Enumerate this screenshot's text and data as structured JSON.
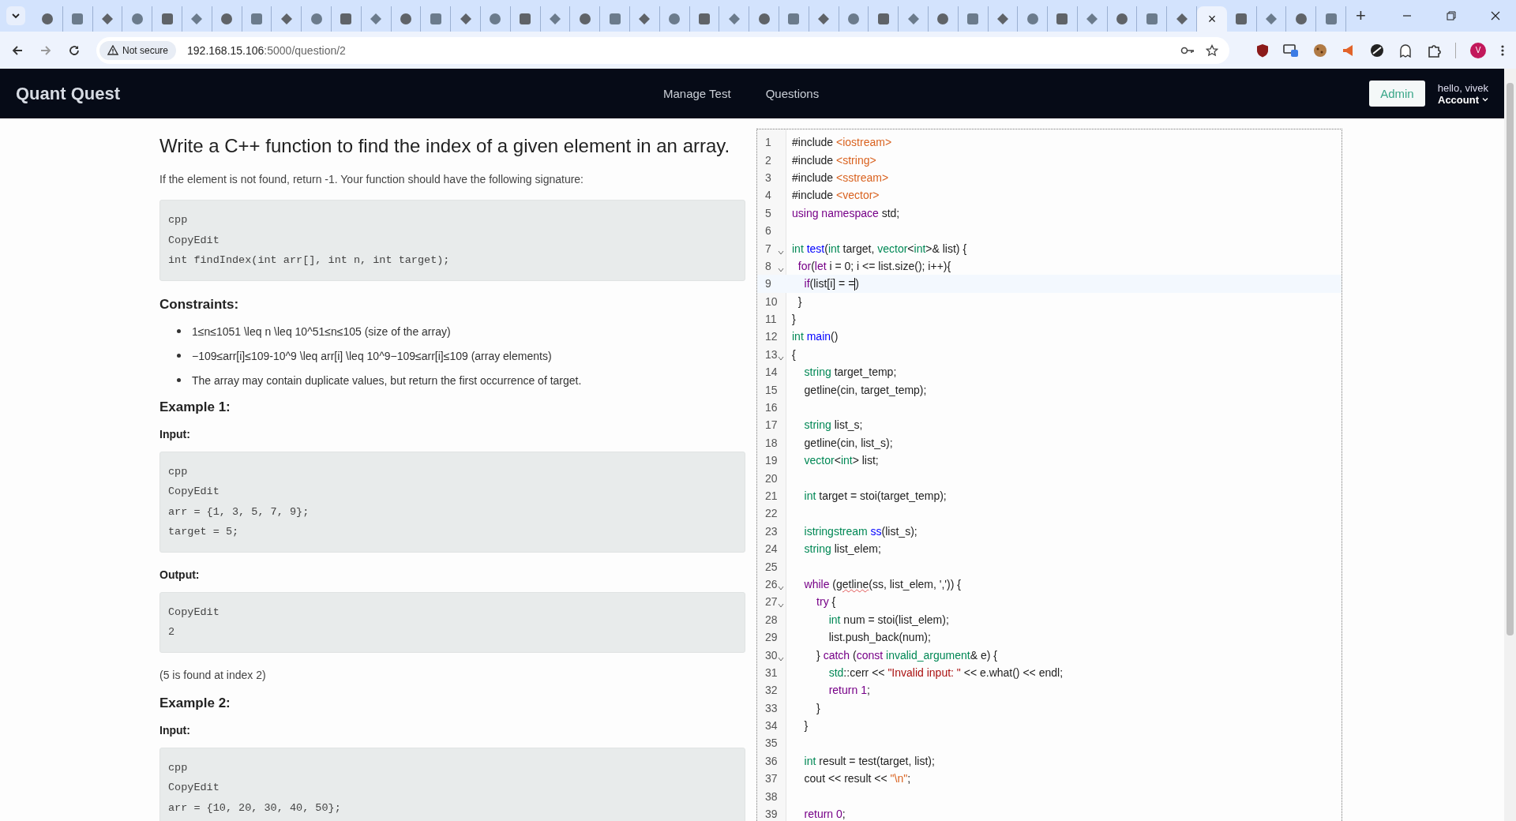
{
  "browser": {
    "tabs": [
      {
        "selected": false
      },
      {
        "selected": false
      },
      {
        "selected": false
      },
      {
        "selected": false
      },
      {
        "selected": false
      },
      {
        "selected": false
      },
      {
        "selected": false
      },
      {
        "selected": false
      },
      {
        "selected": false
      },
      {
        "selected": false
      },
      {
        "selected": false
      },
      {
        "selected": false
      },
      {
        "selected": false
      },
      {
        "selected": false
      },
      {
        "selected": false
      },
      {
        "selected": false
      },
      {
        "selected": false
      },
      {
        "selected": false
      },
      {
        "selected": false
      },
      {
        "selected": false
      },
      {
        "selected": false
      },
      {
        "selected": false
      },
      {
        "selected": false
      },
      {
        "selected": false
      },
      {
        "selected": false
      },
      {
        "selected": false
      },
      {
        "selected": false
      },
      {
        "selected": false
      },
      {
        "selected": false
      },
      {
        "selected": false
      },
      {
        "selected": false
      },
      {
        "selected": false
      },
      {
        "selected": false
      },
      {
        "selected": false
      },
      {
        "selected": false
      },
      {
        "selected": false
      },
      {
        "selected": false
      },
      {
        "selected": false
      },
      {
        "selected": false
      },
      {
        "selected": true
      },
      {
        "selected": false
      },
      {
        "selected": false
      },
      {
        "selected": false
      },
      {
        "selected": false
      }
    ],
    "close_glyph": "×",
    "new_tab": "+",
    "security": "Not secure",
    "url_host": "192.168.15.106",
    "url_rest": ":5000/question/2",
    "profile": "V"
  },
  "navbar": {
    "brand": "Quant Quest",
    "links": [
      "Manage Test",
      "Questions"
    ],
    "admin": "Admin",
    "greeting": "hello, vivek",
    "account": "Account"
  },
  "question": {
    "title": "Write a C++ function to find the index of a given element in an array.",
    "blocks": [
      {
        "kind": "paragraph",
        "text": "If the element is not found, return -1. Your function should have the following signature:"
      },
      {
        "kind": "code",
        "lines": [
          "cpp",
          "CopyEdit",
          "int findIndex(int arr[], int n, int target);"
        ]
      },
      {
        "kind": "heading",
        "text": "Constraints:"
      },
      {
        "kind": "list",
        "items": [
          "1≤n≤1051 \\leq n \\leq 10^51≤n≤105 (size of the array)",
          "−109≤arr[i]≤109-10^9 \\leq arr[i] \\leq 10^9−109≤arr[i]≤109 (array elements)",
          "The array may contain duplicate values, but return the first occurrence of target."
        ]
      },
      {
        "kind": "heading",
        "text": "Example 1:"
      },
      {
        "kind": "label",
        "text": "Input:"
      },
      {
        "kind": "code",
        "lines": [
          "cpp",
          "CopyEdit",
          "arr = {1, 3, 5, 7, 9};",
          "target = 5;"
        ]
      },
      {
        "kind": "label",
        "text": "Output:"
      },
      {
        "kind": "code",
        "lines": [
          "CopyEdit",
          "2"
        ]
      },
      {
        "kind": "paragraph",
        "text": "(5 is found at index 2)"
      },
      {
        "kind": "heading",
        "text": "Example 2:"
      },
      {
        "kind": "label",
        "text": "Input:"
      },
      {
        "kind": "code",
        "lines": [
          "cpp",
          "CopyEdit",
          "arr = {10, 20, 30, 40, 50};"
        ]
      }
    ]
  },
  "editor": {
    "lines": [
      {
        "number": "1",
        "foldable": false,
        "active": false,
        "tokens": [
          {
            "kind": "plain",
            "text": "#include "
          },
          {
            "kind": "include",
            "text": "<iostream>"
          }
        ]
      },
      {
        "number": "2",
        "foldable": false,
        "active": false,
        "tokens": [
          {
            "kind": "plain",
            "text": "#include "
          },
          {
            "kind": "include",
            "text": "<string>"
          }
        ]
      },
      {
        "number": "3",
        "foldable": false,
        "active": false,
        "tokens": [
          {
            "kind": "plain",
            "text": "#include "
          },
          {
            "kind": "include",
            "text": "<sstream>"
          }
        ]
      },
      {
        "number": "4",
        "foldable": false,
        "active": false,
        "tokens": [
          {
            "kind": "plain",
            "text": "#include "
          },
          {
            "kind": "include",
            "text": "<vector>"
          }
        ]
      },
      {
        "number": "5",
        "foldable": false,
        "active": false,
        "tokens": [
          {
            "kind": "keyword",
            "text": "using namespace"
          },
          {
            "kind": "plain",
            "text": " std;"
          }
        ]
      },
      {
        "number": "6",
        "foldable": false,
        "active": false
      },
      {
        "number": "7",
        "foldable": true,
        "active": false,
        "tokens": [
          {
            "kind": "type",
            "text": "int"
          },
          {
            "kind": "def",
            "text": " test"
          },
          {
            "kind": "plain",
            "text": "("
          },
          {
            "kind": "type",
            "text": "int"
          },
          {
            "kind": "plain",
            "text": " target, "
          },
          {
            "kind": "type",
            "text": "vector"
          },
          {
            "kind": "plain",
            "text": "<"
          },
          {
            "kind": "type",
            "text": "int"
          },
          {
            "kind": "plain",
            "text": ">& list) {"
          }
        ]
      },
      {
        "number": "8",
        "foldable": true,
        "active": false,
        "tokens": [
          {
            "kind": "keyword",
            "text": "  for"
          },
          {
            "kind": "plain",
            "text": "("
          },
          {
            "kind": "keyword",
            "text": "let"
          },
          {
            "kind": "plain",
            "text": " i = 0; i <= list.size(); i++){"
          }
        ]
      },
      {
        "number": "9",
        "foldable": false,
        "active": true,
        "tokens": [
          {
            "kind": "keyword",
            "text": "    if"
          },
          {
            "kind": "plain",
            "text": "(list[i] = ="
          },
          {
            "kind": "cursor"
          },
          {
            "kind": "plain",
            "text": ")"
          }
        ]
      },
      {
        "number": "10",
        "foldable": false,
        "active": false,
        "tokens": [
          {
            "kind": "plain",
            "text": "  }"
          }
        ]
      },
      {
        "number": "11",
        "foldable": false,
        "active": false,
        "tokens": [
          {
            "kind": "plain",
            "text": "}"
          }
        ]
      },
      {
        "number": "12",
        "foldable": false,
        "active": false,
        "tokens": [
          {
            "kind": "type",
            "text": "int"
          },
          {
            "kind": "def",
            "text": " main"
          },
          {
            "kind": "plain",
            "text": "()"
          }
        ]
      },
      {
        "number": "13",
        "foldable": true,
        "active": false,
        "tokens": [
          {
            "kind": "plain",
            "text": "{"
          }
        ]
      },
      {
        "number": "14",
        "foldable": false,
        "active": false,
        "tokens": [
          {
            "kind": "type",
            "text": "    string"
          },
          {
            "kind": "plain",
            "text": " target_temp;"
          }
        ]
      },
      {
        "number": "15",
        "foldable": false,
        "active": false,
        "tokens": [
          {
            "kind": "plain",
            "text": "    getline(cin, target_temp);"
          }
        ]
      },
      {
        "number": "16",
        "foldable": false,
        "active": false
      },
      {
        "number": "17",
        "foldable": false,
        "active": false,
        "tokens": [
          {
            "kind": "type",
            "text": "    string"
          },
          {
            "kind": "plain",
            "text": " list_s;"
          }
        ]
      },
      {
        "number": "18",
        "foldable": false,
        "active": false,
        "tokens": [
          {
            "kind": "plain",
            "text": "    getline(cin, list_s);"
          }
        ]
      },
      {
        "number": "19",
        "foldable": false,
        "active": false,
        "tokens": [
          {
            "kind": "type",
            "text": "    vector"
          },
          {
            "kind": "plain",
            "text": "<"
          },
          {
            "kind": "type",
            "text": "int"
          },
          {
            "kind": "plain",
            "text": "> list;"
          }
        ]
      },
      {
        "number": "20",
        "foldable": false,
        "active": false
      },
      {
        "number": "21",
        "foldable": false,
        "active": false,
        "tokens": [
          {
            "kind": "type",
            "text": "    int"
          },
          {
            "kind": "plain",
            "text": " target = stoi(target_temp);"
          }
        ]
      },
      {
        "number": "22",
        "foldable": false,
        "active": false
      },
      {
        "number": "23",
        "foldable": false,
        "active": false,
        "tokens": [
          {
            "kind": "type",
            "text": "    istringstream"
          },
          {
            "kind": "def",
            "text": " ss"
          },
          {
            "kind": "plain",
            "text": "(list_s);"
          }
        ]
      },
      {
        "number": "24",
        "foldable": false,
        "active": false,
        "tokens": [
          {
            "kind": "type",
            "text": "    string"
          },
          {
            "kind": "plain",
            "text": " list_elem;"
          }
        ]
      },
      {
        "number": "25",
        "foldable": false,
        "active": false
      },
      {
        "number": "26",
        "foldable": true,
        "active": false,
        "tokens": [
          {
            "kind": "keyword",
            "text": "    while"
          },
          {
            "kind": "plain",
            "text": " ("
          },
          {
            "kind": "misspelled",
            "text": "getline"
          },
          {
            "kind": "plain",
            "text": "(ss, list_elem, ',')) {"
          }
        ]
      },
      {
        "number": "27",
        "foldable": true,
        "active": false,
        "tokens": [
          {
            "kind": "keyword",
            "text": "        try"
          },
          {
            "kind": "plain",
            "text": " {"
          }
        ]
      },
      {
        "number": "28",
        "foldable": false,
        "active": false,
        "tokens": [
          {
            "kind": "type",
            "text": "            int"
          },
          {
            "kind": "plain",
            "text": " num = stoi(list_elem);"
          }
        ]
      },
      {
        "number": "29",
        "foldable": false,
        "active": false,
        "tokens": [
          {
            "kind": "plain",
            "text": "            list.push_back(num);"
          }
        ]
      },
      {
        "number": "30",
        "foldable": true,
        "active": false,
        "tokens": [
          {
            "kind": "plain",
            "text": "        } "
          },
          {
            "kind": "keyword",
            "text": "catch"
          },
          {
            "kind": "plain",
            "text": " ("
          },
          {
            "kind": "keyword",
            "text": "const"
          },
          {
            "kind": "type",
            "text": " invalid_argument"
          },
          {
            "kind": "plain",
            "text": "& e) {"
          }
        ]
      },
      {
        "number": "31",
        "foldable": false,
        "active": false,
        "tokens": [
          {
            "kind": "type",
            "text": "            std"
          },
          {
            "kind": "plain",
            "text": "::cerr << "
          },
          {
            "kind": "string",
            "text": "\"Invalid input: \""
          },
          {
            "kind": "plain",
            "text": " << e.what() << endl;"
          }
        ]
      },
      {
        "number": "32",
        "foldable": false,
        "active": false,
        "tokens": [
          {
            "kind": "keyword",
            "text": "            return"
          },
          {
            "kind": "number",
            "text": " 1"
          },
          {
            "kind": "plain",
            "text": ";"
          }
        ]
      },
      {
        "number": "33",
        "foldable": false,
        "active": false,
        "tokens": [
          {
            "kind": "plain",
            "text": "        }"
          }
        ]
      },
      {
        "number": "34",
        "foldable": false,
        "active": false,
        "tokens": [
          {
            "kind": "plain",
            "text": "    }"
          }
        ]
      },
      {
        "number": "35",
        "foldable": false,
        "active": false
      },
      {
        "number": "36",
        "foldable": false,
        "active": false,
        "tokens": [
          {
            "kind": "type",
            "text": "    int"
          },
          {
            "kind": "plain",
            "text": " result = test(target, list);"
          }
        ]
      },
      {
        "number": "37",
        "foldable": false,
        "active": false,
        "tokens": [
          {
            "kind": "plain",
            "text": "    cout << result << "
          },
          {
            "kind": "include",
            "text": "\"\\n\""
          },
          {
            "kind": "plain",
            "text": ";"
          }
        ]
      },
      {
        "number": "38",
        "foldable": false,
        "active": false
      },
      {
        "number": "39",
        "foldable": false,
        "active": false,
        "tokens": [
          {
            "kind": "keyword",
            "text": "    return"
          },
          {
            "kind": "number",
            "text": " 0"
          },
          {
            "kind": "plain",
            "text": ";"
          }
        ]
      }
    ]
  }
}
